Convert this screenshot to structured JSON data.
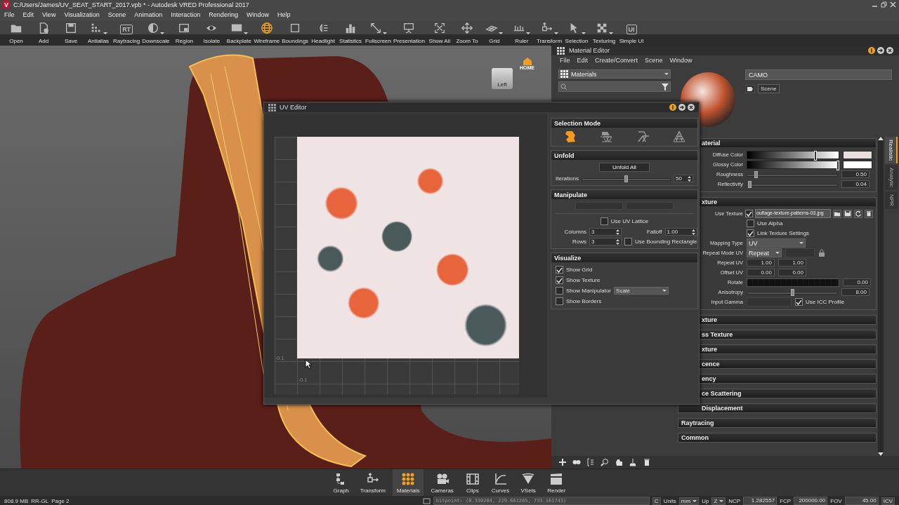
{
  "window": {
    "logo": "V",
    "title": "C:/Users/James/UV_SEAT_START_2017.vpb * - Autodesk VRED Professional 2017"
  },
  "menu": [
    "File",
    "Edit",
    "View",
    "Visualization",
    "Scene",
    "Animation",
    "Interaction",
    "Rendering",
    "Window",
    "Help"
  ],
  "toolbar": [
    {
      "label": "Open",
      "selected": false,
      "has_menu": false
    },
    {
      "label": "Add",
      "selected": false,
      "has_menu": false
    },
    {
      "label": "Save",
      "selected": false,
      "has_menu": false
    },
    {
      "label": "Antialias",
      "selected": false,
      "has_menu": true
    },
    {
      "label": "Raytracing",
      "icon_text": "RT",
      "selected": false,
      "has_menu": false
    },
    {
      "label": "Downscale",
      "selected": false,
      "has_menu": true
    },
    {
      "label": "Region",
      "selected": false,
      "has_menu": false
    },
    {
      "label": "Isolate",
      "selected": false,
      "has_menu": false
    },
    {
      "label": "Backplate",
      "selected": false,
      "has_menu": true
    },
    {
      "label": "Wireframe",
      "selected": true,
      "has_menu": false
    },
    {
      "label": "Boundings",
      "selected": false,
      "has_menu": false
    },
    {
      "label": "Headlight",
      "selected": false,
      "has_menu": false
    },
    {
      "label": "Statistics",
      "selected": false,
      "has_menu": false
    },
    {
      "label": "Fullscreen",
      "selected": false,
      "has_menu": true
    },
    {
      "label": "Presentation",
      "selected": false,
      "has_menu": false
    },
    {
      "label": "Show All",
      "selected": false,
      "has_menu": false
    },
    {
      "label": "Zoom To",
      "selected": false,
      "has_menu": false
    },
    {
      "label": "Grid",
      "selected": false,
      "has_menu": true
    },
    {
      "label": "Ruler",
      "selected": false,
      "has_menu": true
    },
    {
      "label": "Transform",
      "selected": false,
      "has_menu": true
    },
    {
      "label": "Selection",
      "selected": false,
      "has_menu": true
    },
    {
      "label": "Texturing",
      "selected": false,
      "has_menu": true
    },
    {
      "label": "Simple UI",
      "icon_text": "UI",
      "selected": false,
      "has_menu": false
    }
  ],
  "viewport": {
    "nav_cube": {
      "home": "HOME",
      "face": "Left"
    }
  },
  "uv_editor": {
    "title": "UV Editor",
    "axis_labels": [
      "-0.1",
      "-0.1"
    ],
    "selection_mode": {
      "title": "Selection Mode",
      "modes": [
        {
          "selected": true
        },
        {
          "selected": false
        },
        {
          "selected": false
        },
        {
          "selected": false
        }
      ]
    },
    "unfold": {
      "title": "Unfold",
      "button": "Unfold All",
      "iterations": {
        "label": "Iterations",
        "level": 0.5,
        "value": "50"
      }
    },
    "manipulate": {
      "title": "Manipulate",
      "buttons": [
        {
          "disabled": true
        },
        {
          "disabled": true
        }
      ],
      "use_uv_lattice": {
        "label": "Use UV Lattice",
        "checked": false
      },
      "columns": {
        "label": "Columns",
        "value": "3"
      },
      "falloff": {
        "label": "Falloff",
        "value": "1.00"
      },
      "rows": {
        "label": "Rows",
        "value": "3"
      },
      "use_bounding_rectangle": {
        "label": "Use Bounding Rectangle",
        "checked": false
      }
    },
    "visualize": {
      "title": "Visualize",
      "options": [
        {
          "label": "Show Grid",
          "checked": true
        },
        {
          "label": "Show Texture",
          "checked": true
        },
        {
          "label": "Show Manipulator",
          "checked": false,
          "dropdown": "Scale"
        },
        {
          "label": "Show Borders",
          "checked": false
        }
      ]
    }
  },
  "material_editor": {
    "title": "Material Editor",
    "menu": [
      "File",
      "Edit",
      "Create/Convert",
      "Scene",
      "Window"
    ],
    "library": "Materials",
    "material_name": "CAMO",
    "scene_button": "Scene",
    "side_tabs": [
      {
        "label": "Realistic",
        "selected": true
      },
      {
        "label": "Analytic",
        "selected": false
      },
      {
        "label": "NPR",
        "selected": false
      }
    ],
    "sections": [
      {
        "title": "aterial",
        "expanded": true,
        "rows": [
          {
            "kind": "color",
            "label": "Diffuse Color",
            "level": 0.73,
            "color": "#eadfdf"
          },
          {
            "kind": "color",
            "label": "Glossy Color",
            "level": 0.98,
            "color": "#ffffff"
          },
          {
            "kind": "slider",
            "label": "Roughness",
            "level": 0.1,
            "value": "0.50"
          },
          {
            "kind": "slider",
            "label": "Reflectivity",
            "level": 0.03,
            "value": "0.04"
          }
        ]
      },
      {
        "title": "xture",
        "expanded": true,
        "rows": [
          {
            "kind": "texture",
            "label": "Use Texture",
            "checked": true,
            "value": "ouflage-texture-patterns-03.jpg"
          },
          {
            "kind": "checkbox",
            "label": "Use Alpha",
            "checked": false
          },
          {
            "kind": "checkbox",
            "label": "Link Texture Settings",
            "checked": true
          },
          {
            "kind": "dropdown",
            "label": "Mapping Type",
            "value": "UV"
          },
          {
            "kind": "repeat",
            "label": "Repeat Mode UV",
            "value": "Repeat"
          },
          {
            "kind": "pair",
            "label": "Repeat UV",
            "values": [
              "1.00",
              "1.00"
            ]
          },
          {
            "kind": "pair",
            "label": "Offset UV",
            "values": [
              "0.00",
              "0.00"
            ]
          },
          {
            "kind": "rotate",
            "label": "Rotate",
            "value": "0.00"
          },
          {
            "kind": "slider",
            "label": "Anisotropy",
            "level": 0.5,
            "value": "8.00"
          },
          {
            "kind": "gamma",
            "label": "Input Gamma",
            "check_label": "Use ICC Profile",
            "checked": true
          }
        ]
      },
      {
        "title": "xture",
        "expanded": false
      },
      {
        "title": "ss Texture",
        "expanded": false
      },
      {
        "title": "xture",
        "expanded": false
      },
      {
        "title": "cence",
        "expanded": false
      },
      {
        "title": "ency",
        "expanded": false
      },
      {
        "title": "ce Scattering",
        "expanded": false
      },
      {
        "title": "Displacement",
        "expanded": false
      },
      {
        "title": "Raytracing",
        "expanded": false
      },
      {
        "title": "Common",
        "expanded": false
      }
    ]
  },
  "dock": [
    {
      "label": "Graph",
      "selected": false
    },
    {
      "label": "Transform",
      "selected": false
    },
    {
      "label": "Materials",
      "selected": true
    },
    {
      "label": "Cameras",
      "selected": false
    },
    {
      "label": "Clips",
      "selected": false
    },
    {
      "label": "Curves",
      "selected": false
    },
    {
      "label": "VSets",
      "selected": false
    },
    {
      "label": "Render",
      "selected": false
    }
  ],
  "status_bar": {
    "memory": "808.9 MB",
    "renderer": "RR-GL",
    "page": "Page 2",
    "hitpoint": "hitpoint: (0.330204, 229.661285, 733.161743)",
    "c_button": "C",
    "units": {
      "label": "Units",
      "value": "mm"
    },
    "up": {
      "label": "Up",
      "value": "Z"
    },
    "ncp": {
      "label": "NCP",
      "value": "1.282557"
    },
    "fcp": {
      "label": "FCP",
      "value": "200000.00"
    },
    "fov": {
      "label": "FOV",
      "value": "45.00"
    },
    "icv": "ICV"
  }
}
